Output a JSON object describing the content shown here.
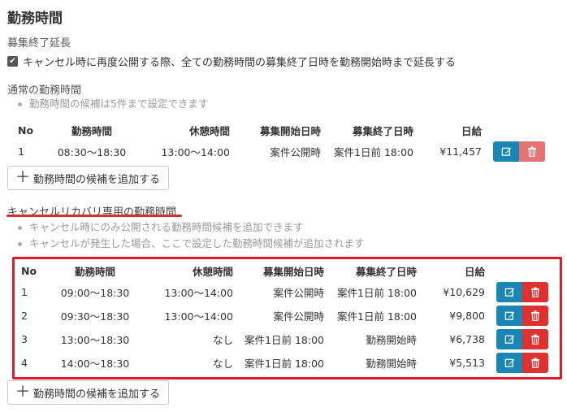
{
  "page": {
    "title": "勤務時間"
  },
  "extension": {
    "label": "募集終了延長",
    "checkbox_label": "キャンセル時に再度公開する際、全ての勤務時間の募集終了日時を勤務開始時まで延長する",
    "checked": true
  },
  "normal": {
    "label": "通常の勤務時間",
    "notes": [
      "勤務時間の候補は5件まで設定できます"
    ],
    "headers": {
      "no": "No",
      "work_time": "勤務時間",
      "break_time": "休憩時間",
      "recruit_start": "募集開始日時",
      "recruit_end": "募集終了日時",
      "daily_pay": "日給"
    },
    "rows": [
      {
        "no": "1",
        "work_time": "08:30〜18:30",
        "break_time": "13:00〜14:00",
        "recruit_start": "案件公開時",
        "recruit_end": "案件1日前 18:00",
        "daily_pay": "¥11,457"
      }
    ],
    "add_button": "勤務時間の候補を追加する"
  },
  "cancel_recovery": {
    "label": "キャンセルリカバリ専用の勤務時間",
    "notes": [
      "キャンセル時にのみ公開される勤務時間候補を追加できます",
      "キャンセルが発生した場合、ここで設定した勤務時間候補が追加されます"
    ],
    "headers": {
      "no": "No",
      "work_time": "勤務時間",
      "break_time": "休憩時間",
      "recruit_start": "募集開始日時",
      "recruit_end": "募集終了日時",
      "daily_pay": "日給"
    },
    "rows": [
      {
        "no": "1",
        "work_time": "09:00〜18:30",
        "break_time": "13:00〜14:00",
        "recruit_start": "案件公開時",
        "recruit_end": "案件1日前 18:00",
        "daily_pay": "¥10,629"
      },
      {
        "no": "2",
        "work_time": "09:30〜18:30",
        "break_time": "13:00〜14:00",
        "recruit_start": "案件公開時",
        "recruit_end": "案件1日前 18:00",
        "daily_pay": "¥9,800"
      },
      {
        "no": "3",
        "work_time": "13:00〜18:30",
        "break_time": "なし",
        "recruit_start": "案件1日前 18:00",
        "recruit_end": "勤務開始時",
        "daily_pay": "¥6,738"
      },
      {
        "no": "4",
        "work_time": "14:00〜18:30",
        "break_time": "なし",
        "recruit_start": "案件1日前 18:00",
        "recruit_end": "勤務開始時",
        "daily_pay": "¥5,513"
      }
    ],
    "add_button": "勤務時間の候補を追加する"
  },
  "icons": {
    "edit": "edit-icon",
    "delete": "trash-icon",
    "add": "plus-icon",
    "check": "check-icon"
  },
  "colors": {
    "edit_button": "#1a86b5",
    "delete_button": "#e03131",
    "delete_button_soft": "#e57373",
    "highlight": "#e01c2b"
  }
}
